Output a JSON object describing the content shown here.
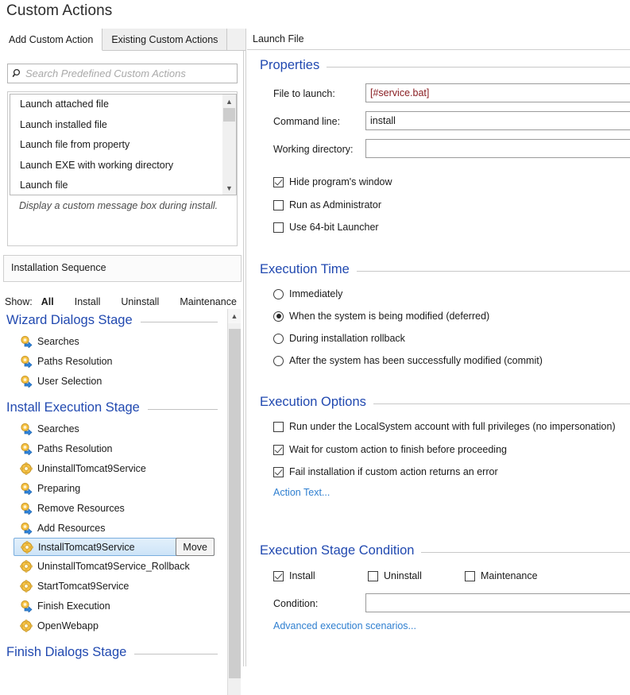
{
  "page_title": "Custom Actions",
  "left": {
    "tabs": [
      {
        "label": "Add Custom Action",
        "active": true
      },
      {
        "label": "Existing Custom Actions",
        "active": false
      }
    ],
    "search": {
      "placeholder": "Search Predefined Custom Actions",
      "value": ""
    },
    "predefined_actions": [
      "Launch attached file",
      "Launch installed file",
      "Launch file from property",
      "Launch EXE with working directory",
      "Launch file"
    ],
    "predefined_description": "Display a custom message box during install.",
    "sequence_panel_title": "Installation Sequence",
    "show_filter": {
      "label": "Show:",
      "options": [
        "All",
        "Install",
        "Uninstall",
        "Maintenance"
      ],
      "selected": "All"
    },
    "stages": [
      {
        "title": "Wizard Dialogs Stage",
        "items": [
          {
            "label": "Searches",
            "icon": "standard-action-icon",
            "selected": false
          },
          {
            "label": "Paths Resolution",
            "icon": "standard-action-icon",
            "selected": false
          },
          {
            "label": "User Selection",
            "icon": "standard-action-icon",
            "selected": false
          }
        ]
      },
      {
        "title": "Install Execution Stage",
        "items": [
          {
            "label": "Searches",
            "icon": "standard-action-icon",
            "selected": false
          },
          {
            "label": "Paths Resolution",
            "icon": "standard-action-icon",
            "selected": false
          },
          {
            "label": "UninstallTomcat9Service",
            "icon": "custom-action-icon",
            "selected": false
          },
          {
            "label": "Preparing",
            "icon": "standard-action-icon",
            "selected": false
          },
          {
            "label": "Remove Resources",
            "icon": "standard-action-icon",
            "selected": false
          },
          {
            "label": "Add Resources",
            "icon": "standard-action-icon",
            "selected": false
          },
          {
            "label": "InstallTomcat9Service",
            "icon": "custom-action-icon",
            "selected": true,
            "move_label": "Move"
          },
          {
            "label": "UninstallTomcat9Service_Rollback",
            "icon": "custom-action-icon",
            "selected": false
          },
          {
            "label": "StartTomcat9Service",
            "icon": "custom-action-icon",
            "selected": false
          },
          {
            "label": "Finish Execution",
            "icon": "standard-action-icon",
            "selected": false
          },
          {
            "label": "OpenWebapp",
            "icon": "custom-action-icon",
            "selected": false
          }
        ]
      },
      {
        "title": "Finish Dialogs Stage",
        "items": []
      }
    ]
  },
  "right": {
    "title": "Launch File",
    "properties": {
      "group_title": "Properties",
      "file_to_launch": {
        "label": "File to launch:",
        "value": "[#service.bat]"
      },
      "command_line": {
        "label": "Command line:",
        "value": "install"
      },
      "working_directory": {
        "label": "Working directory:",
        "value": ""
      },
      "checkboxes": [
        {
          "label": "Hide program's window",
          "checked": true
        },
        {
          "label": "Run as Administrator",
          "checked": false
        },
        {
          "label": "Use 64-bit Launcher",
          "checked": false
        }
      ]
    },
    "execution_time": {
      "group_title": "Execution Time",
      "options": [
        {
          "label": "Immediately",
          "selected": false
        },
        {
          "label": "When the system is being modified (deferred)",
          "selected": true
        },
        {
          "label": "During installation rollback",
          "selected": false
        },
        {
          "label": "After the system has been successfully modified (commit)",
          "selected": false
        }
      ]
    },
    "execution_options": {
      "group_title": "Execution Options",
      "checkboxes": [
        {
          "label": "Run under the LocalSystem account with full privileges (no impersonation)",
          "checked": false
        },
        {
          "label": "Wait for custom action to finish before proceeding",
          "checked": true
        },
        {
          "label": "Fail installation if custom action returns an error",
          "checked": true
        }
      ],
      "action_text_link": "Action Text..."
    },
    "execution_stage_condition": {
      "group_title": "Execution Stage Condition",
      "checkboxes": [
        {
          "label": "Install",
          "checked": true
        },
        {
          "label": "Uninstall",
          "checked": false
        },
        {
          "label": "Maintenance",
          "checked": false
        }
      ],
      "condition": {
        "label": "Condition:",
        "value": ""
      },
      "advanced_link": "Advanced execution scenarios..."
    }
  },
  "colors": {
    "group_heading": "#2149b0",
    "link": "#2f7fd0",
    "field_value_red": "#8a1f23",
    "selection_border": "#7aaede"
  }
}
